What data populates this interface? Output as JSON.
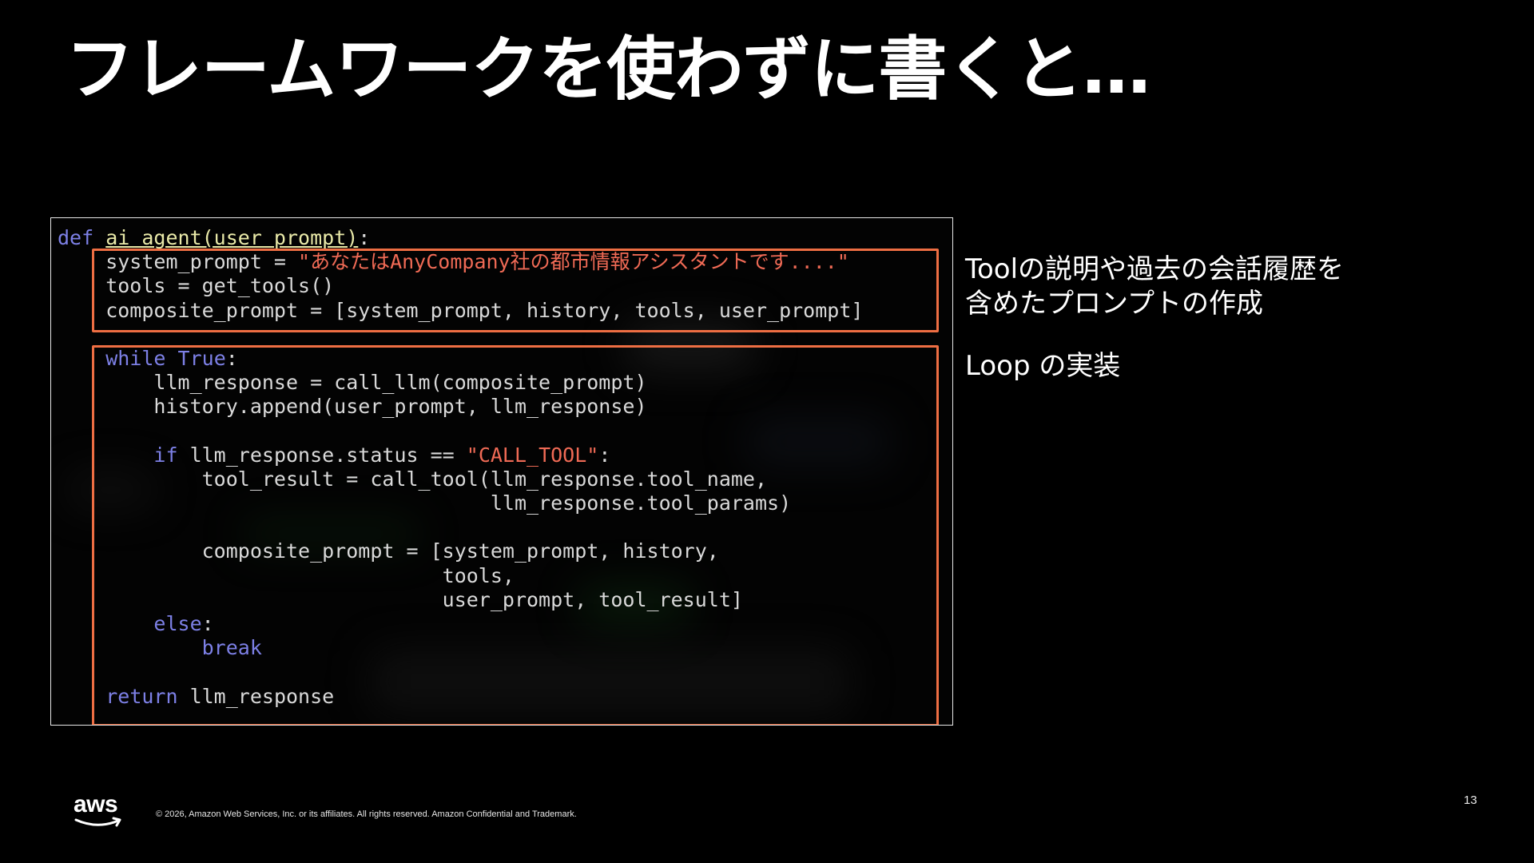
{
  "slide": {
    "title": "フレームワークを使わずに書くと…",
    "page_number": "13",
    "copyright": "© 2026, Amazon Web Services, Inc. or its affiliates. All rights reserved. Amazon Confidential and Trademark.",
    "logo_text": "aws"
  },
  "code": {
    "lines": [
      [
        {
          "t": "def",
          "c": "kw"
        },
        {
          "t": " "
        },
        {
          "t": "ai_agent(user_prompt)",
          "c": "fn"
        },
        {
          "t": ":"
        }
      ],
      [
        {
          "t": "    system_prompt = "
        },
        {
          "t": "\"あなたはAnyCompany社の都市情報アシスタントです....\"",
          "c": "str"
        }
      ],
      [
        {
          "t": "    tools = get_tools()"
        }
      ],
      [
        {
          "t": "    composite_prompt = [system_prompt, history, tools, user_prompt]"
        }
      ],
      [
        {
          "t": ""
        }
      ],
      [
        {
          "t": "    "
        },
        {
          "t": "while",
          "c": "kw"
        },
        {
          "t": " "
        },
        {
          "t": "True",
          "c": "kw"
        },
        {
          "t": ":"
        }
      ],
      [
        {
          "t": "        llm_response = call_llm(composite_prompt)"
        }
      ],
      [
        {
          "t": "        history.append(user_prompt, llm_response)"
        }
      ],
      [
        {
          "t": ""
        }
      ],
      [
        {
          "t": "        "
        },
        {
          "t": "if",
          "c": "kw"
        },
        {
          "t": " llm_response.status == "
        },
        {
          "t": "\"CALL_TOOL\"",
          "c": "str"
        },
        {
          "t": ":"
        }
      ],
      [
        {
          "t": "            tool_result = call_tool(llm_response.tool_name,"
        }
      ],
      [
        {
          "t": "                                    llm_response.tool_params)"
        }
      ],
      [
        {
          "t": ""
        }
      ],
      [
        {
          "t": "            composite_prompt = [system_prompt, history,"
        }
      ],
      [
        {
          "t": "                                tools,"
        }
      ],
      [
        {
          "t": "                                user_prompt, tool_result]"
        }
      ],
      [
        {
          "t": "        "
        },
        {
          "t": "else",
          "c": "kw"
        },
        {
          "t": ":"
        }
      ],
      [
        {
          "t": "            "
        },
        {
          "t": "break",
          "c": "kw"
        }
      ],
      [
        {
          "t": ""
        }
      ],
      [
        {
          "t": "    "
        },
        {
          "t": "return",
          "c": "kw"
        },
        {
          "t": " llm_response"
        }
      ]
    ]
  },
  "annotations": {
    "prompt_note": [
      "Toolの説明や過去の会話履歴を",
      "含めたプロンプトの作成"
    ],
    "loop_note": "Loop の実装"
  },
  "colors": {
    "keyword": "#7d80e6",
    "string": "#ef6a55",
    "function": "#e9e9a8",
    "highlight_border": "#ee6e43",
    "background": "#000000"
  },
  "icons": [
    "aws-logo-icon"
  ]
}
